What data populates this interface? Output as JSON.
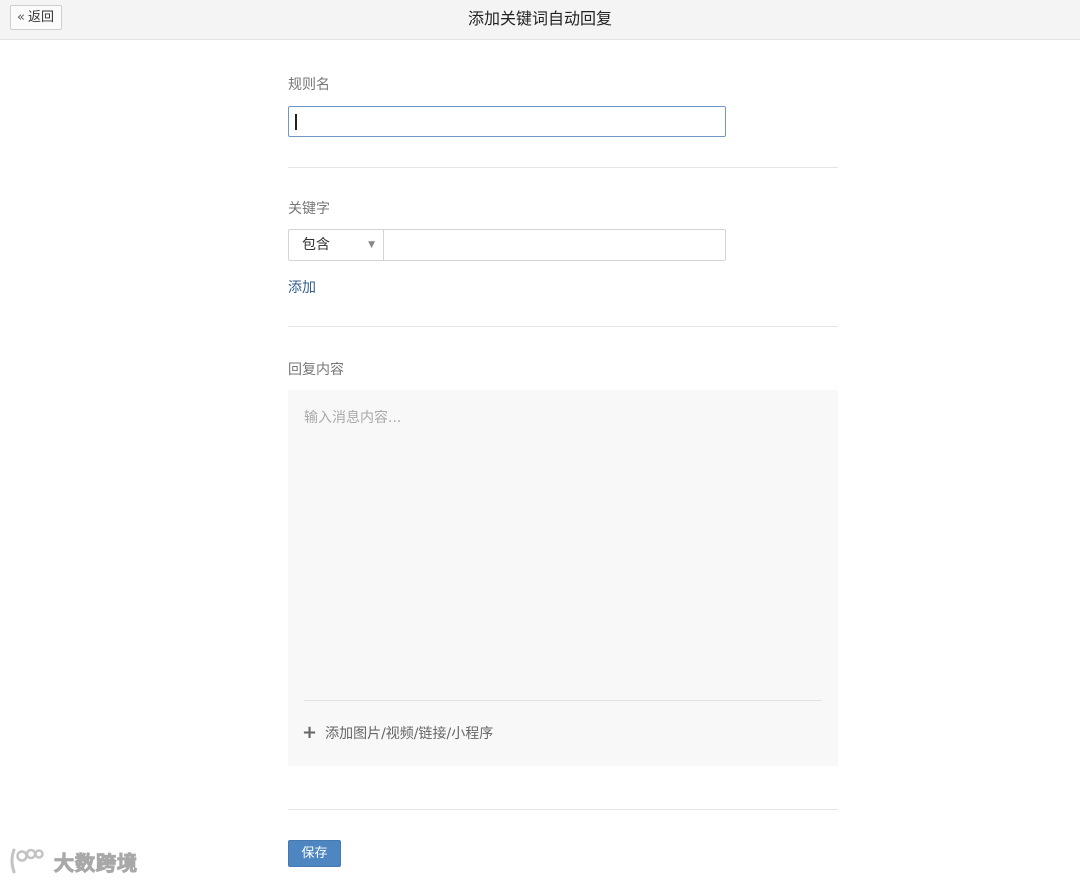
{
  "header": {
    "back_label": "返回",
    "back_icon": "double-chevron-left-icon",
    "title": "添加关键词自动回复"
  },
  "rule": {
    "label": "规则名",
    "value": ""
  },
  "keyword": {
    "label": "关键字",
    "match_mode": "包含",
    "value": "",
    "add_label": "添加"
  },
  "reply": {
    "label": "回复内容",
    "placeholder": "输入消息内容...",
    "attach_label": "添加图片/视频/链接/小程序",
    "attach_icon": "plus-icon"
  },
  "actions": {
    "save_label": "保存"
  },
  "watermark": {
    "text": "大数跨境"
  },
  "colors": {
    "primary_button": "#4e86c2",
    "link": "#345d8d",
    "input_focus_border": "#6f98c4",
    "topbar_bg": "#f4f4f4"
  }
}
